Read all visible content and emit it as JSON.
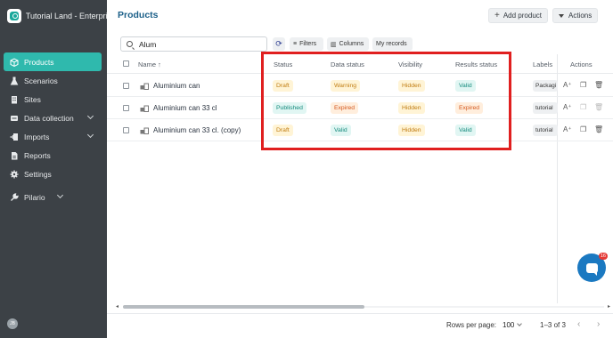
{
  "app": {
    "title": "Tutorial Land - Enterpris",
    "avatar_initials": "JB"
  },
  "sidebar": {
    "items": [
      {
        "label": "Products",
        "icon": "box-icon",
        "active": true
      },
      {
        "label": "Scenarios",
        "icon": "flask-icon"
      },
      {
        "label": "Sites",
        "icon": "building-icon"
      },
      {
        "label": "Data collection",
        "icon": "collection-icon",
        "expandable": true
      },
      {
        "label": "Imports",
        "icon": "import-icon",
        "expandable": true
      },
      {
        "label": "Reports",
        "icon": "report-icon"
      },
      {
        "label": "Settings",
        "icon": "gear-icon"
      },
      {
        "label": "Pilario",
        "icon": "wrench-icon",
        "expandable": true
      }
    ]
  },
  "header": {
    "title": "Products",
    "add_label": "Add product",
    "actions_label": "Actions"
  },
  "toolbar": {
    "search_value": "Alum",
    "filters_label": "Filters",
    "columns_label": "Columns",
    "my_records_label": "My records"
  },
  "table": {
    "columns": {
      "name": "Name",
      "status": "Status",
      "data_status": "Data status",
      "visibility": "Visibility",
      "results_status": "Results status",
      "labels": "Labels",
      "actions": "Actions"
    },
    "rows": [
      {
        "name": "Aluminium can",
        "status": "Draft",
        "data_status": "Warning",
        "visibility": "Hidden",
        "results_status": "Valid",
        "label": "Packagi"
      },
      {
        "name": "Aluminium can 33 cl",
        "status": "Published",
        "data_status": "Expired",
        "visibility": "Hidden",
        "results_status": "Expired",
        "label": "tutorial"
      },
      {
        "name": "Aluminium can 33 cl. (copy)",
        "status": "Draft",
        "data_status": "Valid",
        "visibility": "Hidden",
        "results_status": "Valid",
        "label": "tutorial"
      }
    ]
  },
  "footer": {
    "rows_per_page_label": "Rows per page:",
    "rows_per_page_value": "100",
    "range": "1–3 of 3"
  },
  "chat": {
    "count": "16"
  },
  "colors": {
    "accent": "#2fb9ad",
    "sidebar_bg": "#3c4146",
    "title_blue": "#1b5f88",
    "highlight_red": "#e01f1f"
  }
}
